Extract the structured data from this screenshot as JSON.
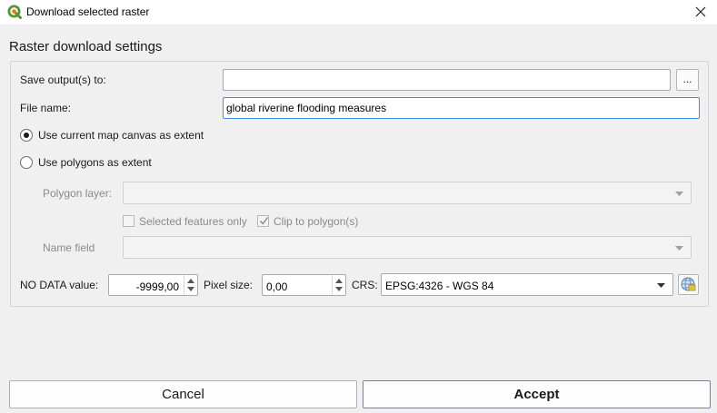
{
  "window": {
    "title": "Download selected raster",
    "icon": "qgis-logo-icon",
    "close_icon": "close-icon"
  },
  "section": {
    "title": "Raster download settings"
  },
  "form": {
    "save_output": {
      "label": "Save output(s) to:",
      "value": "",
      "browse_label": "..."
    },
    "file_name": {
      "label": "File name:",
      "value": "global riverine flooding measures"
    },
    "extent": {
      "option_canvas": "Use current map canvas as extent",
      "option_polygons": "Use polygons as extent",
      "selected": "canvas"
    },
    "polygon_layer": {
      "label": "Polygon layer:",
      "value": ""
    },
    "selected_features_only": {
      "label": "Selected features only",
      "checked": false
    },
    "clip_to_polygon": {
      "label": "Clip to polygon(s)",
      "checked": true
    },
    "name_field": {
      "label": "Name field",
      "value": ""
    },
    "no_data": {
      "label": "NO DATA value:",
      "value": "-9999,00"
    },
    "pixel_size": {
      "label": "Pixel size:",
      "value": "0,00"
    },
    "crs": {
      "label": "CRS:",
      "value": "EPSG:4326 - WGS 84",
      "selector_icon": "globe-crs-icon"
    }
  },
  "buttons": {
    "cancel": "Cancel",
    "accept": "Accept"
  },
  "colors": {
    "focus_border": "#3d8ee6",
    "dialog_bg": "#f0f0f0",
    "qgis_green": "#589632",
    "qgis_yellow": "#ee7913"
  }
}
